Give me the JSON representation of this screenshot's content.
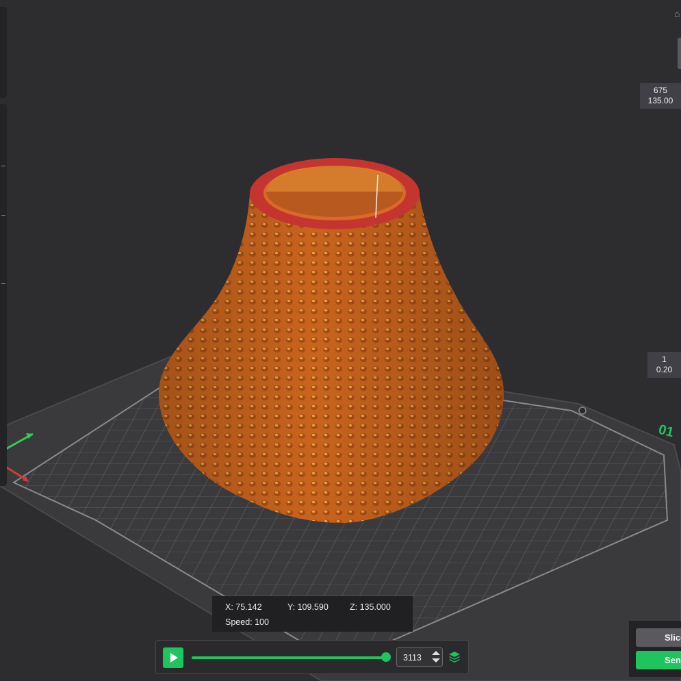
{
  "colors": {
    "accent": "#1fc45e",
    "model": "#c8641e",
    "model_rim": "#c43530",
    "plate": "#3c3c3f",
    "background": "#2d2d30"
  },
  "layer_slider": {
    "top_index": "675",
    "top_height": "135.00",
    "bottom_index": "1",
    "bottom_height": "0.20"
  },
  "plate_label": "01",
  "position": {
    "x": "X: 75.142",
    "y": "Y: 109.590",
    "z": "Z: 135.000",
    "speed": "Speed: 100"
  },
  "playback": {
    "step_value": "3113",
    "play_icon": "play-icon",
    "layers_icon": "layers-icon"
  },
  "actions": {
    "slice_label": "Slice plate",
    "send_label": "Send"
  }
}
